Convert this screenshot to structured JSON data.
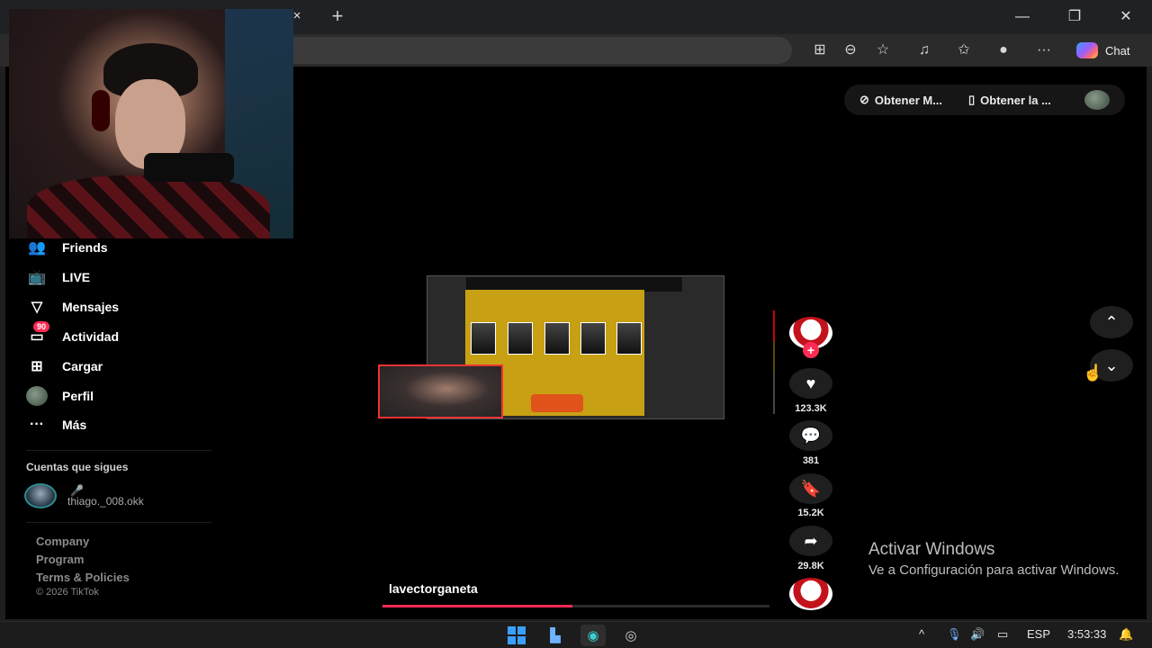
{
  "browser": {
    "tab_new": "+",
    "tab_close": "×",
    "window": {
      "minimize": "—",
      "maximize": "❐",
      "close": "✕"
    },
    "toolbar": {
      "chat_label": "Chat",
      "more": "···"
    }
  },
  "sidebar": {
    "items": [
      {
        "label": "Friends",
        "icon": "friends-icon",
        "glyph": "👥"
      },
      {
        "label": "LIVE",
        "icon": "live-tv-icon",
        "glyph": "📺"
      },
      {
        "label": "Mensajes",
        "icon": "paper-plane-icon",
        "glyph": "▽"
      },
      {
        "label": "Actividad",
        "icon": "inbox-icon",
        "glyph": "▭",
        "badge": "90"
      },
      {
        "label": "Cargar",
        "icon": "upload-plus-icon",
        "glyph": "⊞"
      },
      {
        "label": "Perfil",
        "icon": "profile-avatar",
        "glyph": ""
      },
      {
        "label": "Más",
        "icon": "more-dots-icon",
        "glyph": "···"
      }
    ],
    "following_title": "Cuentas que sigues",
    "following": [
      {
        "name": "🎤",
        "handle": "thiago._008.okk"
      }
    ],
    "footer": {
      "links": [
        "Company",
        "Program",
        "Terms & Policies"
      ],
      "copyright": "© 2026 TikTok"
    }
  },
  "feed": {
    "username": "lavectorganeta",
    "progress": 0.49,
    "actions": {
      "likes": "123.3K",
      "comments": "381",
      "saves": "15.2K",
      "shares": "29.8K"
    },
    "follow_plus": "+"
  },
  "topright": {
    "get_app_1": "Obtener M...",
    "get_app_2": "Obtener la ..."
  },
  "nav": {
    "up": "⌃",
    "down": "⌄"
  },
  "watermark": {
    "title": "Activar Windows",
    "desc": "Ve a Configuración para activar Windows."
  },
  "taskbar": {
    "lang": "ESP",
    "time": "3:53:33",
    "chevron": "^"
  },
  "colors": {
    "accent": "#fe2c55",
    "page_bg": "#000000",
    "chrome_bg": "#202124"
  }
}
